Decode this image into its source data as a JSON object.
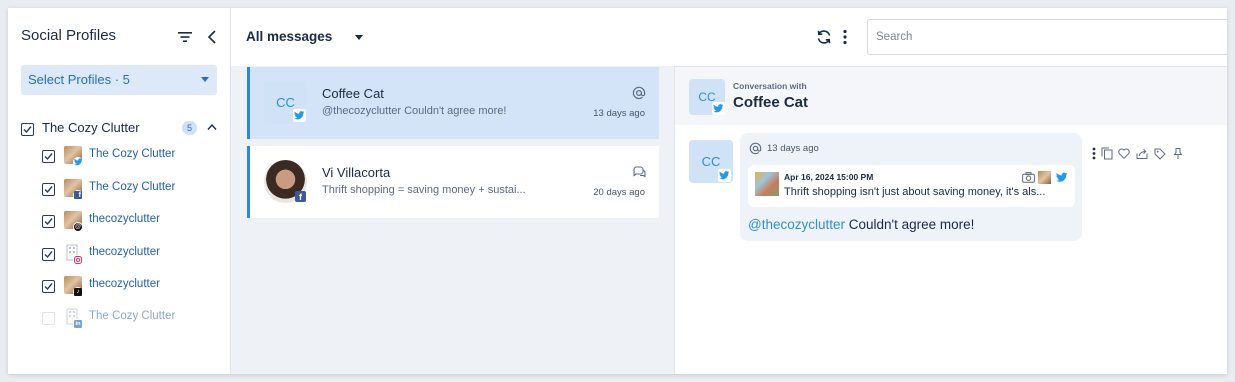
{
  "sidebar": {
    "title": "Social Profiles",
    "select_label": "Select Profiles · 5",
    "group": {
      "label": "The Cozy Clutter",
      "count": "5",
      "checked": true
    },
    "profiles": [
      {
        "label": "The Cozy Clutter",
        "network": "twitter",
        "checked": true
      },
      {
        "label": "The Cozy Clutter",
        "network": "facebook",
        "checked": true
      },
      {
        "label": "thecozyclutter",
        "network": "threads",
        "checked": true
      },
      {
        "label": "thecozyclutter",
        "network": "instagram",
        "checked": true
      },
      {
        "label": "thecozyclutter",
        "network": "tiktok",
        "checked": true
      },
      {
        "label": "The Cozy Clutter",
        "network": "linkedin",
        "checked": false
      }
    ]
  },
  "header": {
    "filter_label": "All messages",
    "search_placeholder": "Search"
  },
  "messages": [
    {
      "initials": "CC",
      "name": "Coffee Cat",
      "preview": "@thecozyclutter Couldn't agree more!",
      "date": "13 days ago",
      "type_icon": "mention-icon",
      "network": "twitter",
      "selected": true
    },
    {
      "initials": "",
      "name": "Vi Villacorta",
      "preview": "Thrift shopping = saving money + sustai...",
      "date": "20 days ago",
      "type_icon": "comment-icon",
      "network": "facebook",
      "selected": false
    }
  ],
  "conversation": {
    "label": "Conversation with",
    "name": "Coffee Cat",
    "initials": "CC",
    "message": {
      "date": "13 days ago",
      "quote_date": "Apr 16, 2024 15:00 PM",
      "quote_text": "Thrift shopping isn't just about saving money, it's als...",
      "mention": "@thecozyclutter",
      "text": " Couldn't agree more!"
    }
  },
  "colors": {
    "accent": "#1f6fcf",
    "twitter": "#1d9bf0",
    "selected_bg": "#d3e4f8"
  }
}
